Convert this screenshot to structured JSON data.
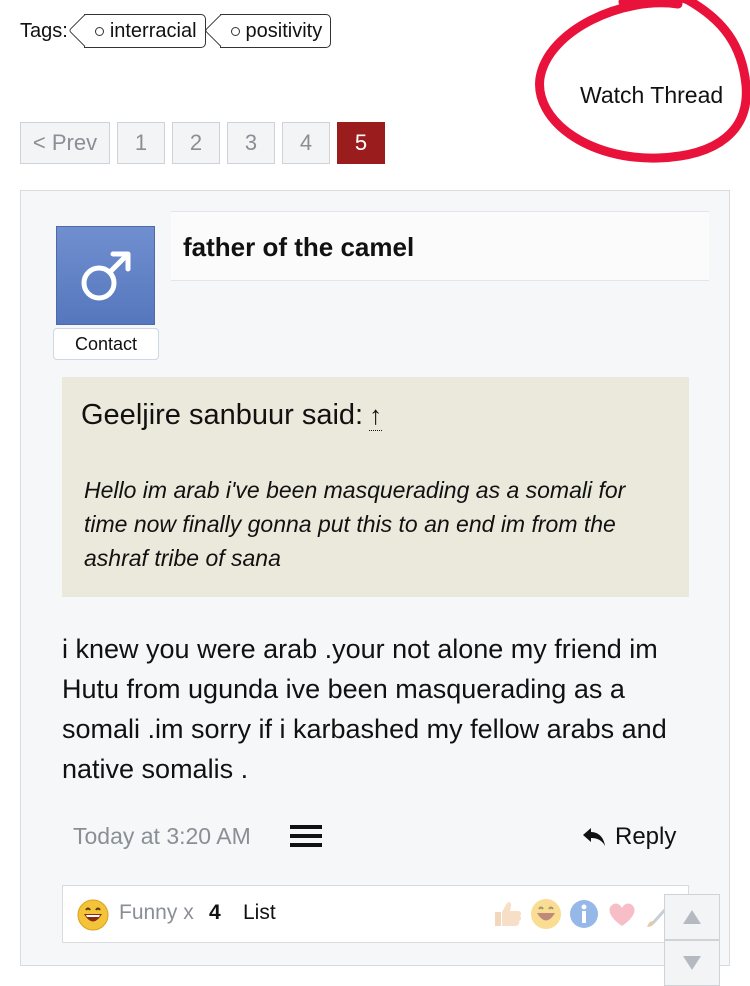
{
  "tags": {
    "label": "Tags:",
    "items": [
      "interracial",
      "positivity"
    ]
  },
  "watch_thread": "Watch Thread",
  "pagination": {
    "prev": "< Prev",
    "pages": [
      "1",
      "2",
      "3",
      "4",
      "5"
    ],
    "current": "5"
  },
  "post": {
    "username": "father of the camel",
    "contact_label": "Contact",
    "quote": {
      "author_line": "Geeljire sanbuur said:",
      "arrow": "↑",
      "text": "Hello im arab i've been masquerading as a somali for time now finally gonna put this to an end im from the ashraf tribe of sana"
    },
    "message": "i knew you were arab .your not alone my friend im Hutu from ugunda ive been masquerading as a somali .im sorry if i karbashed my fellow arabs and native somalis .",
    "timestamp": "Today at 3:20 AM",
    "reply_label": "Reply",
    "reactions": {
      "label": "Funny x",
      "count": "4",
      "list_label": "List",
      "available": [
        "like-icon",
        "funny-icon",
        "informative-icon",
        "love-icon",
        "brush-icon"
      ]
    }
  },
  "colors": {
    "accent_current_page": "#9b1c1c",
    "annotation_circle": "#e8123a",
    "quote_bg": "#ebe8dc",
    "avatar_blue": "#6283c8"
  }
}
